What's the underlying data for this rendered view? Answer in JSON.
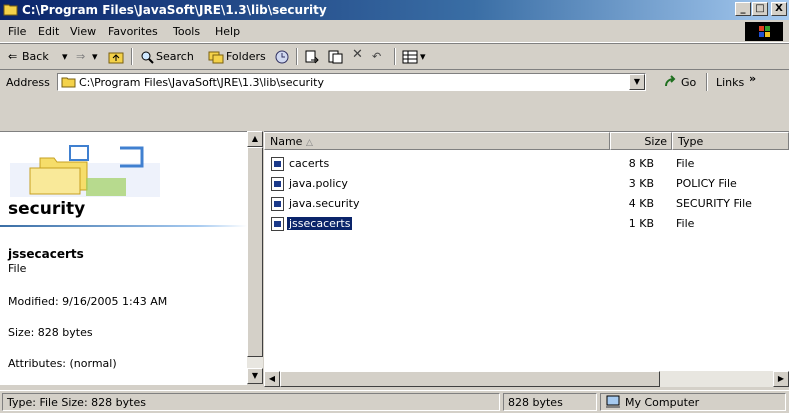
{
  "window": {
    "title": "C:\\Program Files\\JavaSoft\\JRE\\1.3\\lib\\security",
    "minimize": "_",
    "restore": "□",
    "close": "X"
  },
  "menu": [
    "File",
    "Edit",
    "View",
    "Favorites",
    "Tools",
    "Help"
  ],
  "toolbar": {
    "back": "Back",
    "search": "Search",
    "folders": "Folders"
  },
  "address": {
    "label": "Address",
    "value": "C:\\Program Files\\JavaSoft\\JRE\\1.3\\lib\\security",
    "go": "Go",
    "links": "Links"
  },
  "left": {
    "folder_name": "security",
    "selected_name": "jssecacerts",
    "selected_type": "File",
    "modified": "Modified: 9/16/2005 1:43 AM",
    "size": "Size: 828 bytes",
    "attributes": "Attributes: (normal)"
  },
  "columns": {
    "name": "Name",
    "size": "Size",
    "type": "Type"
  },
  "files": [
    {
      "name": "cacerts",
      "size": "8 KB",
      "type": "File"
    },
    {
      "name": "java.policy",
      "size": "3 KB",
      "type": "POLICY File"
    },
    {
      "name": "java.security",
      "size": "4 KB",
      "type": "SECURITY File"
    },
    {
      "name": "jssecacerts",
      "size": "1 KB",
      "type": "File"
    }
  ],
  "status": {
    "text": "Type: File Size: 828 bytes",
    "bytes": "828 bytes",
    "zone": "My Computer"
  }
}
